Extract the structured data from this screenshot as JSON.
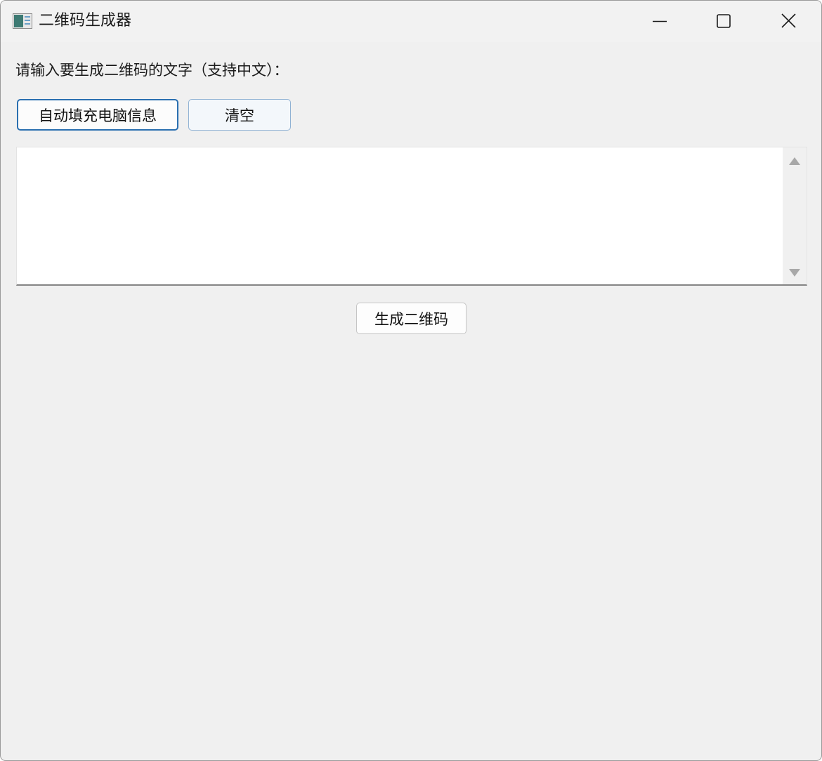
{
  "window": {
    "title": "二维码生成器"
  },
  "form": {
    "prompt_label": "请输入要生成二维码的文字（支持中文）：",
    "autofill_label": "自动填充电脑信息",
    "clear_label": "清空",
    "text_value": "",
    "generate_label": "生成二维码"
  },
  "icons": {
    "app": "app-window-icon",
    "minimize": "minimize-icon",
    "maximize": "maximize-icon",
    "close": "close-icon",
    "scroll_up": "scroll-up-arrow-icon",
    "scroll_down": "scroll-down-arrow-icon"
  },
  "colors": {
    "background": "#f0f0f0",
    "accent_border": "#2a6fb0"
  }
}
